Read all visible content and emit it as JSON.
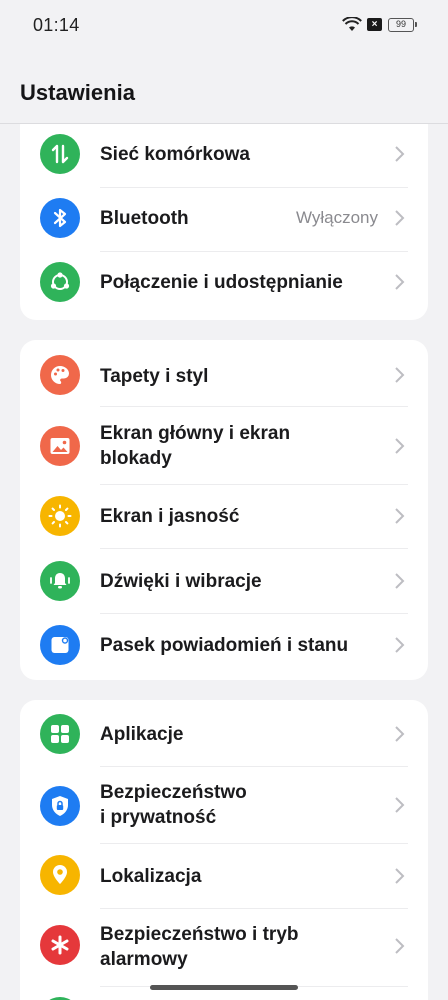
{
  "status_bar": {
    "time": "01:14",
    "battery": "99"
  },
  "header": {
    "title": "Ustawienia"
  },
  "groups": [
    {
      "items": [
        {
          "label": "Sieć komórkowa",
          "icon": "mobile-data-icon",
          "color": "#2fb35a"
        },
        {
          "label": "Bluetooth",
          "value": "Wyłączony",
          "icon": "bluetooth-icon",
          "color": "#1e7cf2"
        },
        {
          "label": "Połączenie i udostępnianie",
          "icon": "share-icon",
          "color": "#2fb35a"
        }
      ]
    },
    {
      "items": [
        {
          "label": "Tapety i styl",
          "icon": "palette-icon",
          "color": "#f0684a"
        },
        {
          "label_line1": "Ekran główny i ekran",
          "label_line2": "blokady",
          "icon": "image-icon",
          "color": "#f0684a"
        },
        {
          "label": "Ekran i jasność",
          "icon": "brightness-icon",
          "color": "#f7b500"
        },
        {
          "label": "Dźwięki i wibracje",
          "icon": "bell-icon",
          "color": "#2fb35a"
        },
        {
          "label": "Pasek powiadomień i stanu",
          "icon": "notification-bar-icon",
          "color": "#1e7cf2"
        }
      ]
    },
    {
      "items": [
        {
          "label": "Aplikacje",
          "icon": "apps-grid-icon",
          "color": "#2fb35a"
        },
        {
          "label_line1": "Bezpieczeństwo",
          "label_line2": "i prywatność",
          "icon": "shield-lock-icon",
          "color": "#1e7cf2"
        },
        {
          "label": "Lokalizacja",
          "icon": "location-pin-icon",
          "color": "#f7b500"
        },
        {
          "label_line1": "Bezpieczeństwo i tryb",
          "label_line2": "alarmowy",
          "icon": "emergency-asterisk-icon",
          "color": "#e5383b"
        }
      ]
    }
  ]
}
